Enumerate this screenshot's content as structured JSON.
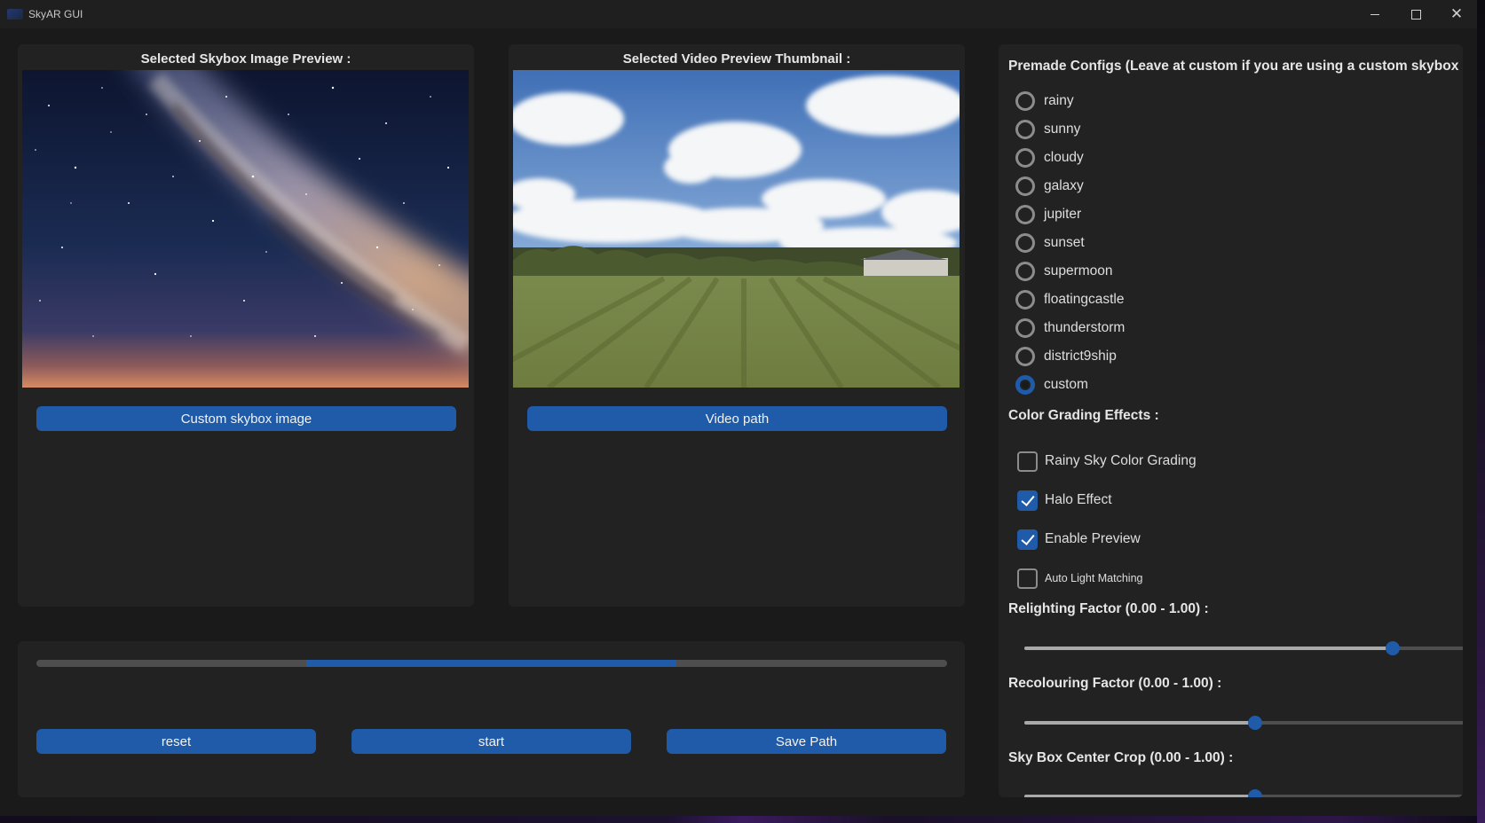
{
  "window": {
    "title": "SkyAR GUI",
    "controls": {
      "minimize": "",
      "maximize": "",
      "close": "✕"
    }
  },
  "skybox_panel": {
    "title": "Selected Skybox Image Preview :",
    "button_label": "Custom skybox image"
  },
  "video_panel": {
    "title": "Selected Video Preview Thumbnail :",
    "button_label": "Video path"
  },
  "bottom_panel": {
    "progress": {
      "start_fraction": 0.296,
      "end_fraction": 0.703
    },
    "reset_label": "reset",
    "start_label": "start",
    "save_label": "Save Path"
  },
  "config_panel": {
    "premade_label": "Premade Configs (Leave at custom if you are using a custom skybox",
    "presets": [
      {
        "label": "rainy",
        "selected": false
      },
      {
        "label": "sunny",
        "selected": false
      },
      {
        "label": "cloudy",
        "selected": false
      },
      {
        "label": "galaxy",
        "selected": false
      },
      {
        "label": "jupiter",
        "selected": false
      },
      {
        "label": "sunset",
        "selected": false
      },
      {
        "label": "supermoon",
        "selected": false
      },
      {
        "label": "floatingcastle",
        "selected": false
      },
      {
        "label": "thunderstorm",
        "selected": false
      },
      {
        "label": "district9ship",
        "selected": false
      },
      {
        "label": "custom",
        "selected": true
      }
    ],
    "color_grading_label": "Color Grading Effects :",
    "effects": [
      {
        "label": "Rainy Sky Color Grading",
        "checked": false
      },
      {
        "label": "Halo Effect",
        "checked": true
      },
      {
        "label": "Enable Preview",
        "checked": true
      },
      {
        "label": "Auto Light Matching",
        "checked": false
      }
    ],
    "sliders": [
      {
        "label": "Relighting Factor (0.00 - 1.00) :",
        "value": 0.83
      },
      {
        "label": "Recolouring Factor (0.00 - 1.00) :",
        "value": 0.52
      },
      {
        "label": "Sky Box Center Crop (0.00 - 1.00) :",
        "value": 0.52
      }
    ]
  },
  "colors": {
    "accent": "#1f5ba8",
    "panel": "#222222",
    "background": "#1a1a1a"
  }
}
